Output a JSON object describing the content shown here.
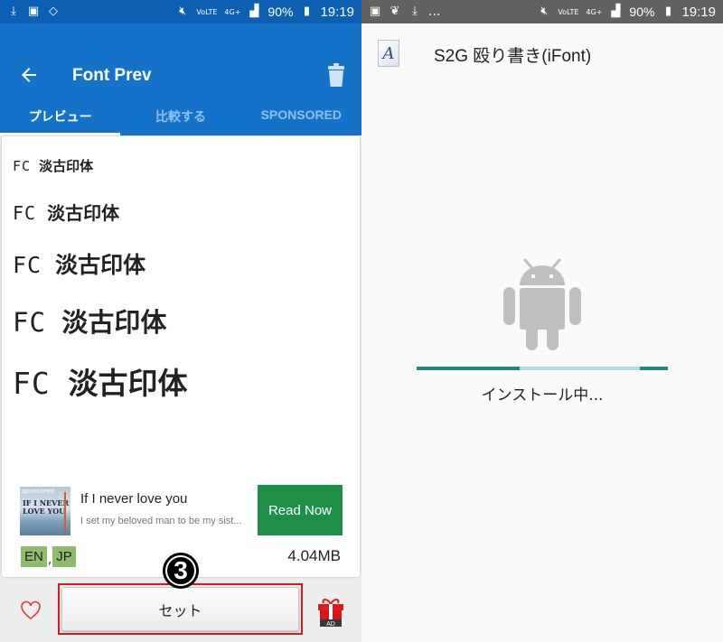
{
  "left_screen": {
    "status_bar": {
      "left_icons": [
        "download-icon",
        "image-icon",
        "screen-rotation-icon"
      ],
      "right_icons": [
        "mute-icon",
        "volte-icon",
        "4g-icon",
        "signal-icon"
      ],
      "volte_label": "VoLTE",
      "network_label": "4G+",
      "battery": "90%",
      "time": "19:19"
    },
    "app_bar": {
      "title": "Font Prev",
      "color": "#1473c9"
    },
    "tabs": [
      {
        "label": "プレビュー",
        "active": true
      },
      {
        "label": "比較する",
        "active": false
      },
      {
        "label": "SPONSORED",
        "active": false
      }
    ],
    "preview": {
      "samples": [
        {
          "latin": "FC",
          "text": "淡古印体"
        },
        {
          "latin": "FC",
          "text": "淡古印体"
        },
        {
          "latin": "FC",
          "text": "淡古印体"
        },
        {
          "latin": "FC",
          "text": "淡古印体"
        },
        {
          "latin": "FC",
          "text": "淡古印体"
        }
      ]
    },
    "ad": {
      "image_badge": "sponsored",
      "image_title_1": "IF I NEVER",
      "image_title_2": "LOVE YOU",
      "title": "If I never love you",
      "description": "I set my beloved man to be my sist...",
      "cta": "Read Now",
      "cta_color": "#1d8f47"
    },
    "languages": [
      "EN",
      "JP"
    ],
    "separator": ",",
    "file_size": "4.04MB",
    "step_marker": "3",
    "set_button": "セット",
    "gift_badge": "AD"
  },
  "right_screen": {
    "status_bar": {
      "left_icons": [
        "image-icon",
        "evernote-icon",
        "download-icon",
        "more-notifications-icon"
      ],
      "more_label": "...",
      "volte_label": "VoLTE",
      "network_label": "4G+",
      "battery": "90%",
      "time": "19:19"
    },
    "package_icon_letter": "A",
    "package_title": "S2G 殴り書き(iFont)",
    "install_status": "インストール中...",
    "progress": {
      "indeterminate": true,
      "bar_color": "#1e8a78",
      "track_color": "#b2dfdb"
    }
  }
}
